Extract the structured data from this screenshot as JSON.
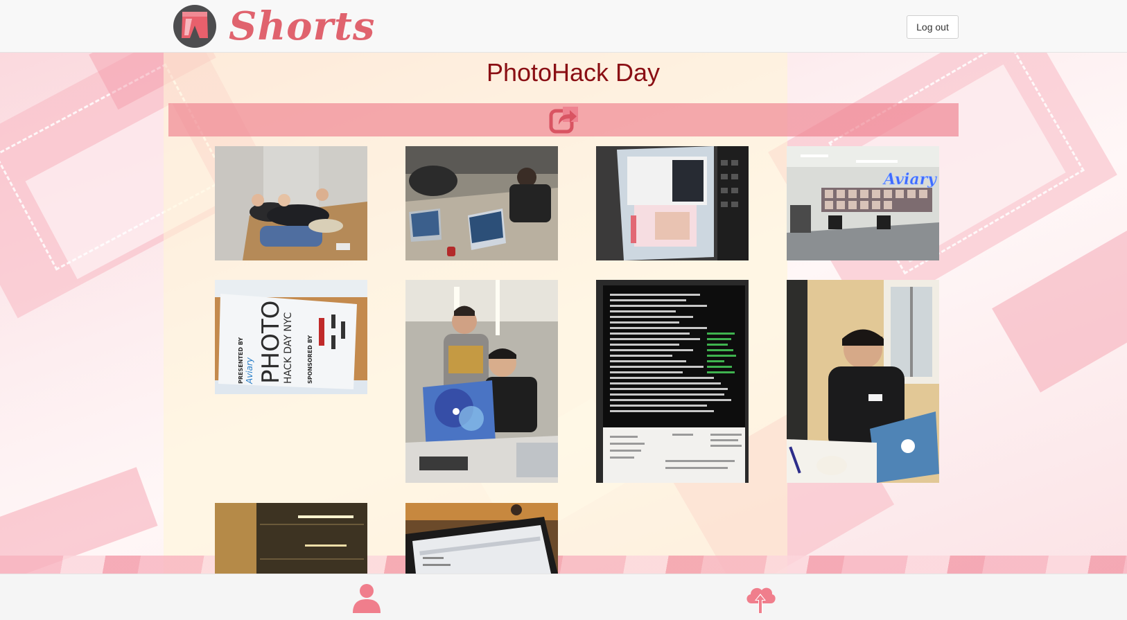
{
  "header": {
    "app_name": "Shorts",
    "logout_label": "Log out"
  },
  "album": {
    "title": "PhotoHack Day",
    "share_icon": "share-icon"
  },
  "photos": [
    {
      "description": "sleeping-hackers"
    },
    {
      "description": "hackers-at-laptops"
    },
    {
      "description": "laptop-with-shorts-app"
    },
    {
      "description": "aviary-office-sign"
    },
    {
      "description": "photo-hack-day-poster"
    },
    {
      "description": "two-hackers-smiling"
    },
    {
      "description": "terminal-on-laptop"
    },
    {
      "description": "hacker-at-desk"
    },
    {
      "description": "hallway-lights"
    },
    {
      "description": "laptop-browser-screen"
    }
  ],
  "poster_text": {
    "presented_by": "PRESENTED BY",
    "brand": "Aviary",
    "main": "PHOTO",
    "sub": "HACK DAY NYC",
    "sponsored": "SPONSORED BY"
  },
  "aviary_sign": "Aviary",
  "footer": {
    "profile_icon": "user-icon",
    "upload_icon": "cloud-upload-icon"
  },
  "colors": {
    "brand": "#e0636e",
    "title": "#8a0f14",
    "share_bar": "#ee808e"
  }
}
